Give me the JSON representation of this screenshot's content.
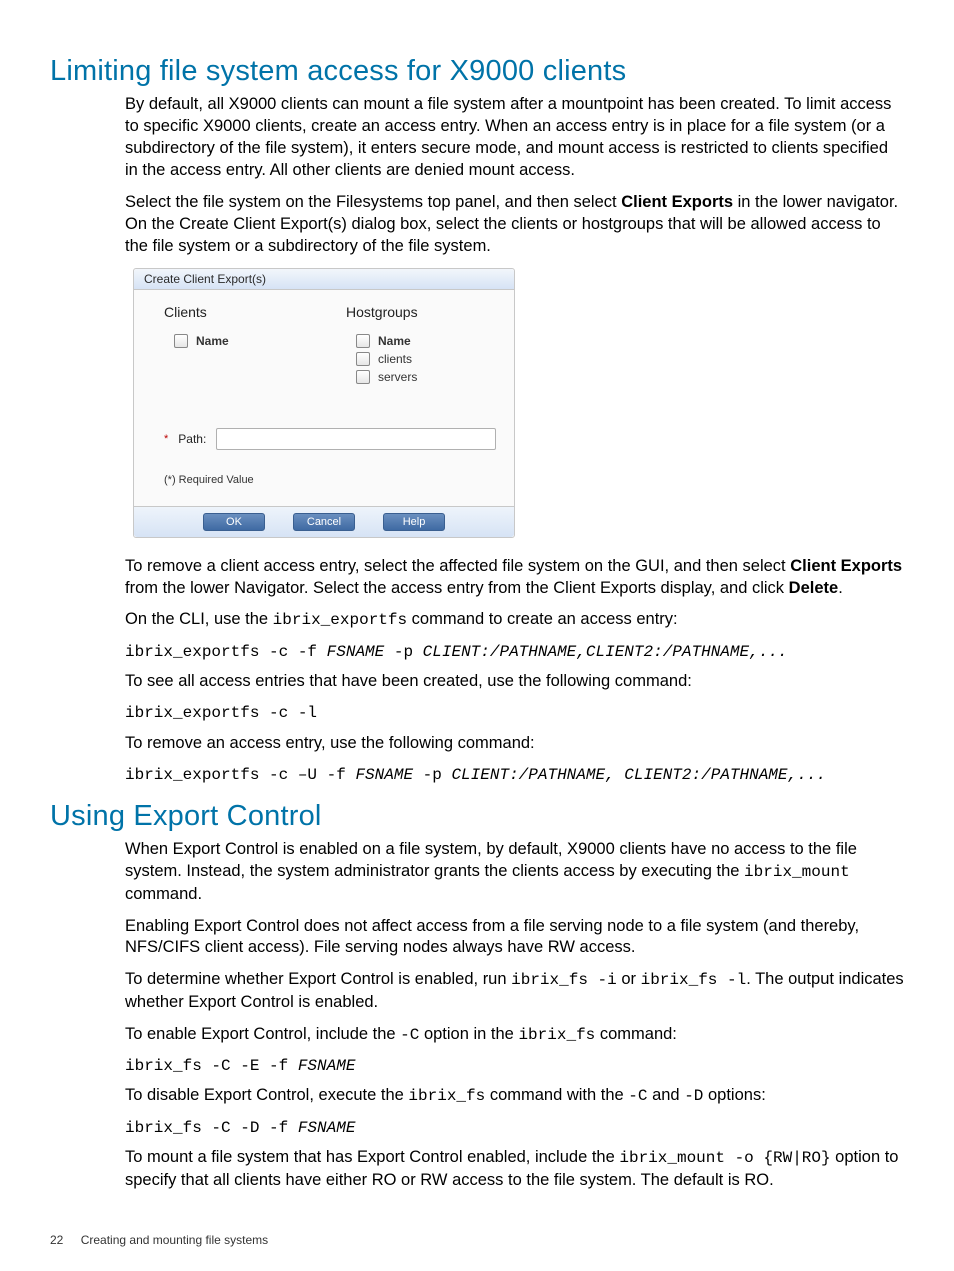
{
  "section1": {
    "heading": "Limiting file system access for X9000 clients",
    "p1": "By default, all X9000 clients can mount a file system after a mountpoint has been created. To limit access to specific X9000 clients, create an access entry. When an access entry is in place for a file system (or a subdirectory of the file system), it enters secure mode, and mount access is restricted to clients specified in the access entry. All other clients are denied mount access.",
    "p2a": "Select the file system on the Filesystems top panel, and then select ",
    "p2b": "Client Exports",
    "p2c": " in the lower navigator. On the Create Client Export(s) dialog box, select the clients or hostgroups that will be allowed access to the file system or a subdirectory of the file system.",
    "p3a": "To remove a client access entry, select the affected file system on the GUI, and then select ",
    "p3b": "Client Exports",
    "p3c": " from the lower Navigator. Select the access entry from the Client Exports display, and click ",
    "p3d": "Delete",
    "p3e": ".",
    "p4a": "On the CLI, use the ",
    "p4b": "ibrix_exportfs",
    "p4c": " command to create an access entry:",
    "cmd1_pre": "ibrix_exportfs -c -f ",
    "cmd1_it1": "FSNAME",
    "cmd1_mid": " -p ",
    "cmd1_it2": "CLIENT:/PATHNAME,CLIENT2:/PATHNAME,...",
    "p5": "To see all access entries that have been created, use the following command:",
    "cmd2": "ibrix_exportfs -c -l",
    "p6": "To remove an access entry, use the following command:",
    "cmd3_pre": "ibrix_exportfs -c –U -f ",
    "cmd3_it1": "FSNAME",
    "cmd3_mid": " -p ",
    "cmd3_it2": "CLIENT:/PATHNAME, CLIENT2:/PATHNAME,..."
  },
  "dialog": {
    "title": "Create Client Export(s)",
    "clients_label": "Clients",
    "hostgroups_label": "Hostgroups",
    "name_header": "Name",
    "hg_items": [
      "clients",
      "servers"
    ],
    "path_label": "Path:",
    "required_note": "(*) Required Value",
    "ok": "OK",
    "cancel": "Cancel",
    "help": "Help"
  },
  "section2": {
    "heading": "Using Export Control",
    "p1a": "When Export Control is enabled on a file system, by default, X9000 clients have no access to the file system. Instead, the system administrator grants the clients access by executing the ",
    "p1b": "ibrix_mount",
    "p1c": " command.",
    "p2": "Enabling Export Control does not affect access from a file serving node to a file system (and thereby, NFS/CIFS client access). File serving nodes always have RW access.",
    "p3a": "To determine whether Export Control is enabled, run ",
    "p3b": "ibrix_fs -i",
    "p3c": " or ",
    "p3d": "ibrix_fs -l",
    "p3e": ". The output indicates whether Export Control is enabled.",
    "p4a": "To enable Export Control, include the ",
    "p4b": "-C",
    "p4c": " option in the ",
    "p4d": "ibrix_fs",
    "p4e": " command:",
    "cmd4_pre": "ibrix_fs -C -E -f ",
    "cmd4_it": "FSNAME",
    "p5a": "To disable Export Control, execute the ",
    "p5b": "ibrix_fs",
    "p5c": " command with the ",
    "p5d": "-C",
    "p5e": " and ",
    "p5f": "-D",
    "p5g": " options:",
    "cmd5_pre": "ibrix_fs -C -D -f ",
    "cmd5_it": "FSNAME",
    "p6a": "To mount a file system that has Export Control enabled, include the ",
    "p6b": "ibrix_mount -o {RW|RO}",
    "p6c": " option to specify that all clients have either RO or RW access to the file system. The default is RO."
  },
  "footer": {
    "page": "22",
    "chapter": "Creating and mounting file systems"
  }
}
